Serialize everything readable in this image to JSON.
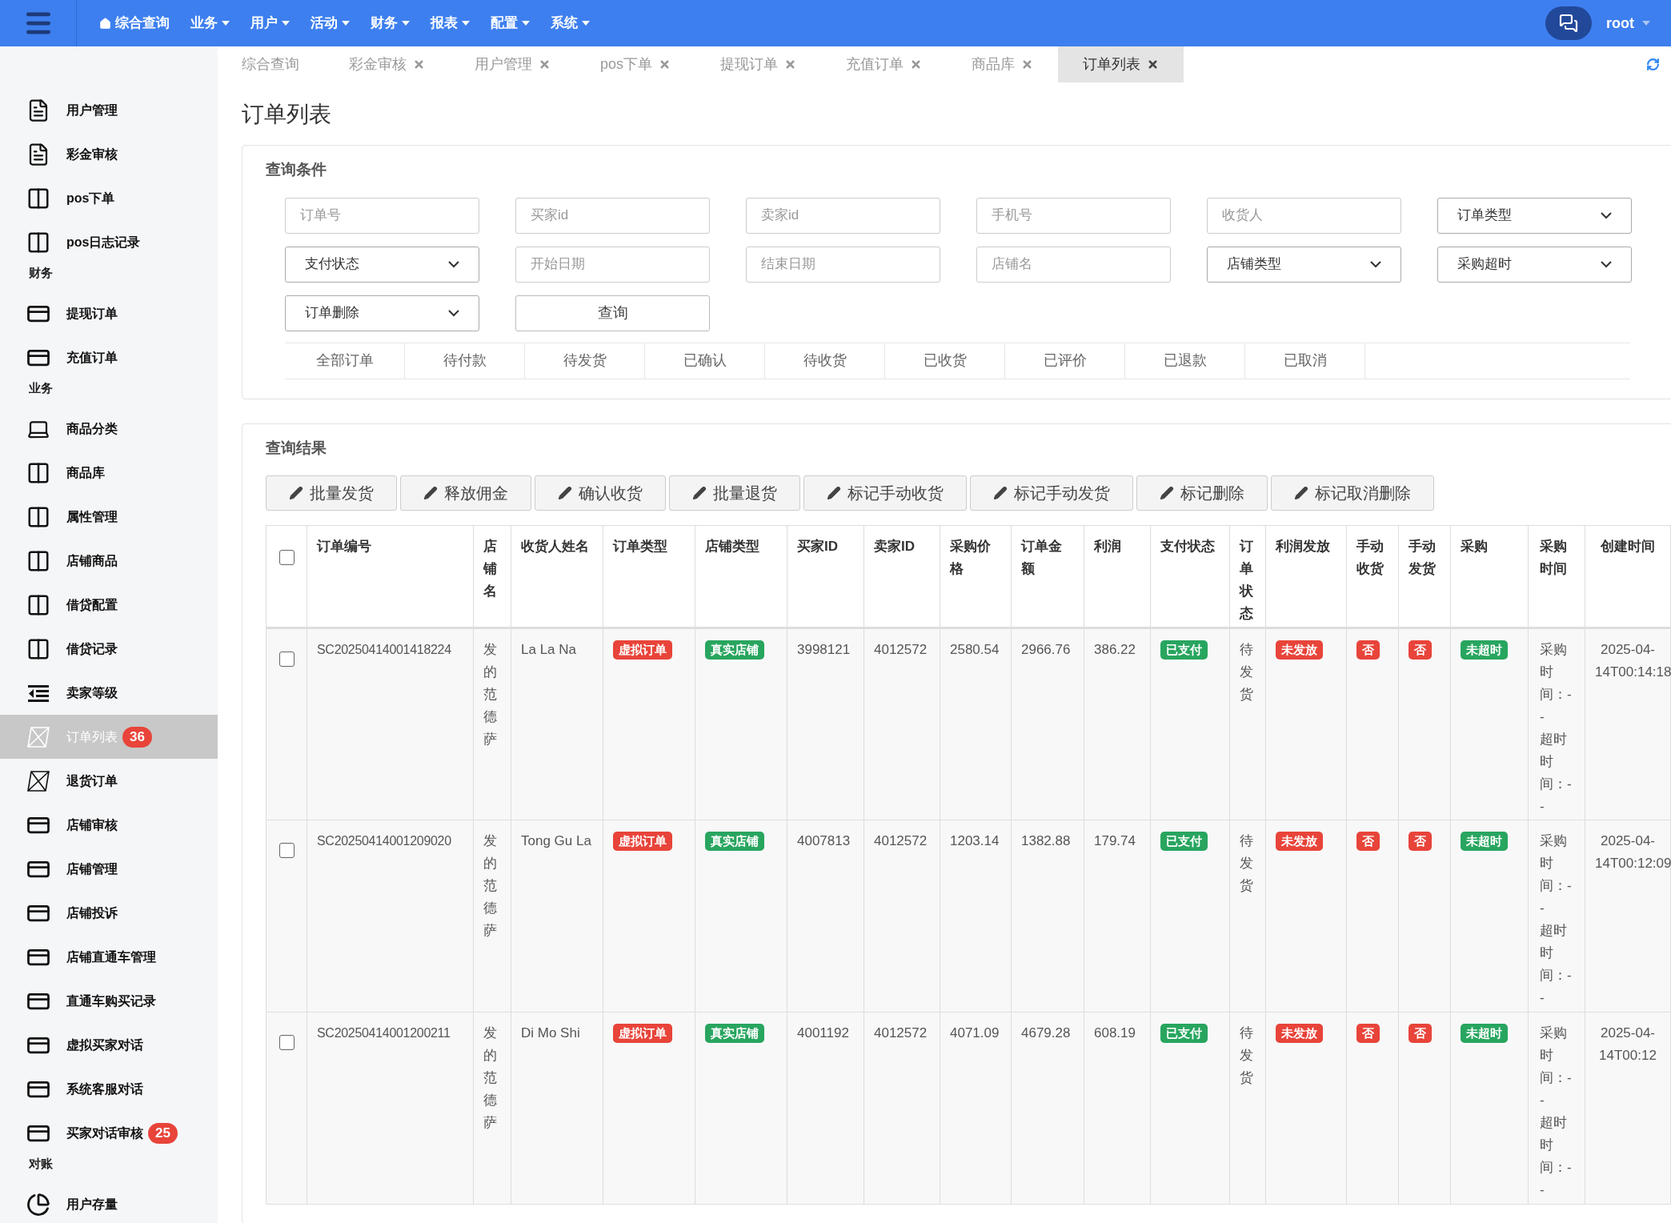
{
  "topbar": {
    "nav": [
      {
        "label": "综合查询",
        "kind": "home"
      },
      {
        "label": "业务",
        "kind": "dropdown"
      },
      {
        "label": "用户",
        "kind": "dropdown"
      },
      {
        "label": "活动",
        "kind": "dropdown"
      },
      {
        "label": "财务",
        "kind": "dropdown"
      },
      {
        "label": "报表",
        "kind": "dropdown"
      },
      {
        "label": "配置",
        "kind": "dropdown"
      },
      {
        "label": "系统",
        "kind": "dropdown"
      }
    ],
    "user": "root"
  },
  "sidebar": {
    "items": [
      {
        "kind": "document",
        "label": "用户管理",
        "selected": false
      },
      {
        "kind": "document",
        "label": "彩金审核",
        "selected": false
      },
      {
        "kind": "columns",
        "label": "pos下单",
        "selected": false
      },
      {
        "kind": "columns",
        "label": "pos日志记录",
        "selected": false
      },
      {
        "kind": "section",
        "label": "财务"
      },
      {
        "kind": "card",
        "label": "提现订单",
        "selected": false
      },
      {
        "kind": "card",
        "label": "充值订单",
        "selected": false
      },
      {
        "kind": "section",
        "label": "业务"
      },
      {
        "kind": "laptop",
        "label": "商品分类",
        "selected": false
      },
      {
        "kind": "columns",
        "label": "商品库",
        "selected": false
      },
      {
        "kind": "columns",
        "label": "属性管理",
        "selected": false
      },
      {
        "kind": "columns",
        "label": "店铺商品",
        "selected": false
      },
      {
        "kind": "columns",
        "label": "借贷配置",
        "selected": false
      },
      {
        "kind": "columns",
        "label": "借贷记录",
        "selected": false
      },
      {
        "kind": "indent",
        "label": "卖家等级",
        "selected": false
      },
      {
        "kind": "crossed",
        "label": "订单列表",
        "selected": true,
        "badge": "36"
      },
      {
        "kind": "crossed",
        "label": "退货订单",
        "selected": false
      },
      {
        "kind": "card",
        "label": "店铺审核",
        "selected": false
      },
      {
        "kind": "card",
        "label": "店铺管理",
        "selected": false
      },
      {
        "kind": "card",
        "label": "店铺投诉",
        "selected": false
      },
      {
        "kind": "card",
        "label": "店铺直通车管理",
        "selected": false
      },
      {
        "kind": "card",
        "label": "直通车购买记录",
        "selected": false
      },
      {
        "kind": "card",
        "label": "虚拟买家对话",
        "selected": false
      },
      {
        "kind": "card",
        "label": "系统客服对话",
        "selected": false
      },
      {
        "kind": "card",
        "label": "买家对话审核",
        "selected": false,
        "badge": "25"
      },
      {
        "kind": "section",
        "label": "对账"
      },
      {
        "kind": "pie",
        "label": "用户存量",
        "selected": false
      }
    ]
  },
  "tabs": [
    {
      "label": "综合查询",
      "closable": false,
      "selected": false
    },
    {
      "label": "彩金审核",
      "closable": true,
      "selected": false
    },
    {
      "label": "用户管理",
      "closable": true,
      "selected": false
    },
    {
      "label": "pos下单",
      "closable": true,
      "selected": false
    },
    {
      "label": "提现订单",
      "closable": true,
      "selected": false
    },
    {
      "label": "充值订单",
      "closable": true,
      "selected": false
    },
    {
      "label": "商品库",
      "closable": true,
      "selected": false
    },
    {
      "label": "订单列表",
      "closable": true,
      "selected": true
    }
  ],
  "page_title": "订单列表",
  "query": {
    "title": "查询条件",
    "fields": [
      {
        "kind": "input",
        "placeholder": "订单号"
      },
      {
        "kind": "input",
        "placeholder": "买家id"
      },
      {
        "kind": "input",
        "placeholder": "卖家id"
      },
      {
        "kind": "input",
        "placeholder": "手机号"
      },
      {
        "kind": "input",
        "placeholder": "收货人"
      },
      {
        "kind": "select",
        "value": "订单类型"
      },
      {
        "kind": "select",
        "value": "支付状态"
      },
      {
        "kind": "input",
        "placeholder": "开始日期"
      },
      {
        "kind": "input",
        "placeholder": "结束日期"
      },
      {
        "kind": "input",
        "placeholder": "店铺名"
      },
      {
        "kind": "select",
        "value": "店铺类型"
      },
      {
        "kind": "select",
        "value": "采购超时"
      },
      {
        "kind": "select",
        "value": "订单删除"
      },
      {
        "kind": "button",
        "label": "查询"
      }
    ],
    "status_tabs": [
      {
        "label": "全部订单",
        "selected": false
      },
      {
        "label": "待付款",
        "selected": false
      },
      {
        "label": "待发货",
        "selected": false
      },
      {
        "label": "已确认",
        "selected": false
      },
      {
        "label": "待收货",
        "selected": false
      },
      {
        "label": "已收货",
        "selected": false
      },
      {
        "label": "已评价",
        "selected": false
      },
      {
        "label": "已退款",
        "selected": false
      },
      {
        "label": "已取消",
        "selected": false
      }
    ]
  },
  "results": {
    "title": "查询结果",
    "actions": [
      "批量发货",
      "释放佣金",
      "确认收货",
      "批量退货",
      "标记手动收货",
      "标记手动发货",
      "标记删除",
      "标记取消删除"
    ],
    "table": {
      "columns": [
        "订单编号",
        "店铺名",
        "收货人姓名",
        "订单类型",
        "店铺类型",
        "买家ID",
        "卖家ID",
        "采购价格",
        "订单金额",
        "利润",
        "支付状态",
        "订单状态",
        "利润发放",
        "手动收货",
        "手动发货",
        "采购",
        "采购时间",
        "创建时间"
      ],
      "select_all_checked": false,
      "rows": [
        {
          "checked": false,
          "order_no": "SC20250414001418224",
          "shop_name": "发的范德萨",
          "receiver": "La La Na",
          "order_type": {
            "text": "虚拟订单",
            "color": "#e8443a"
          },
          "shop_type": {
            "text": "真实店铺",
            "color": "#28a55f"
          },
          "buyer_id": "3998121",
          "seller_id": "4012572",
          "purchase_price": "2580.54",
          "amount": "2966.76",
          "profit": "386.22",
          "pay_status": {
            "text": "已支付",
            "color": "#28a55f"
          },
          "order_status": "待发货",
          "profit_release": {
            "text": "未发放",
            "color": "#e8443a"
          },
          "manual_receive": {
            "text": "否",
            "color": "#e8443a"
          },
          "manual_ship": {
            "text": "否",
            "color": "#e8443a"
          },
          "purchase": {
            "text": "未超时",
            "color": "#28a55f"
          },
          "purchase_time": [
            "采购时间：--",
            "超时时间：--"
          ],
          "created": "2025-04-14T00:14:18"
        },
        {
          "checked": false,
          "order_no": "SC20250414001209020",
          "shop_name": "发的范德萨",
          "receiver": "Tong Gu La",
          "order_type": {
            "text": "虚拟订单",
            "color": "#e8443a"
          },
          "shop_type": {
            "text": "真实店铺",
            "color": "#28a55f"
          },
          "buyer_id": "4007813",
          "seller_id": "4012572",
          "purchase_price": "1203.14",
          "amount": "1382.88",
          "profit": "179.74",
          "pay_status": {
            "text": "已支付",
            "color": "#28a55f"
          },
          "order_status": "待发货",
          "profit_release": {
            "text": "未发放",
            "color": "#e8443a"
          },
          "manual_receive": {
            "text": "否",
            "color": "#e8443a"
          },
          "manual_ship": {
            "text": "否",
            "color": "#e8443a"
          },
          "purchase": {
            "text": "未超时",
            "color": "#28a55f"
          },
          "purchase_time": [
            "采购时间：--",
            "超时时间：--"
          ],
          "created": "2025-04-14T00:12:09"
        },
        {
          "checked": false,
          "order_no": "SC20250414001200211",
          "shop_name": "发的范德萨",
          "receiver": "Di Mo Shi",
          "order_type": {
            "text": "虚拟订单",
            "color": "#e8443a"
          },
          "shop_type": {
            "text": "真实店铺",
            "color": "#28a55f"
          },
          "buyer_id": "4001192",
          "seller_id": "4012572",
          "purchase_price": "4071.09",
          "amount": "4679.28",
          "profit": "608.19",
          "pay_status": {
            "text": "已支付",
            "color": "#28a55f"
          },
          "order_status": "待发货",
          "profit_release": {
            "text": "未发放",
            "color": "#e8443a"
          },
          "manual_receive": {
            "text": "否",
            "color": "#e8443a"
          },
          "manual_ship": {
            "text": "否",
            "color": "#e8443a"
          },
          "purchase": {
            "text": "未超时",
            "color": "#28a55f"
          },
          "purchase_time": [
            "采购时间：--",
            "超时时间：--"
          ],
          "created": "2025-04-14T00:12"
        }
      ]
    }
  }
}
